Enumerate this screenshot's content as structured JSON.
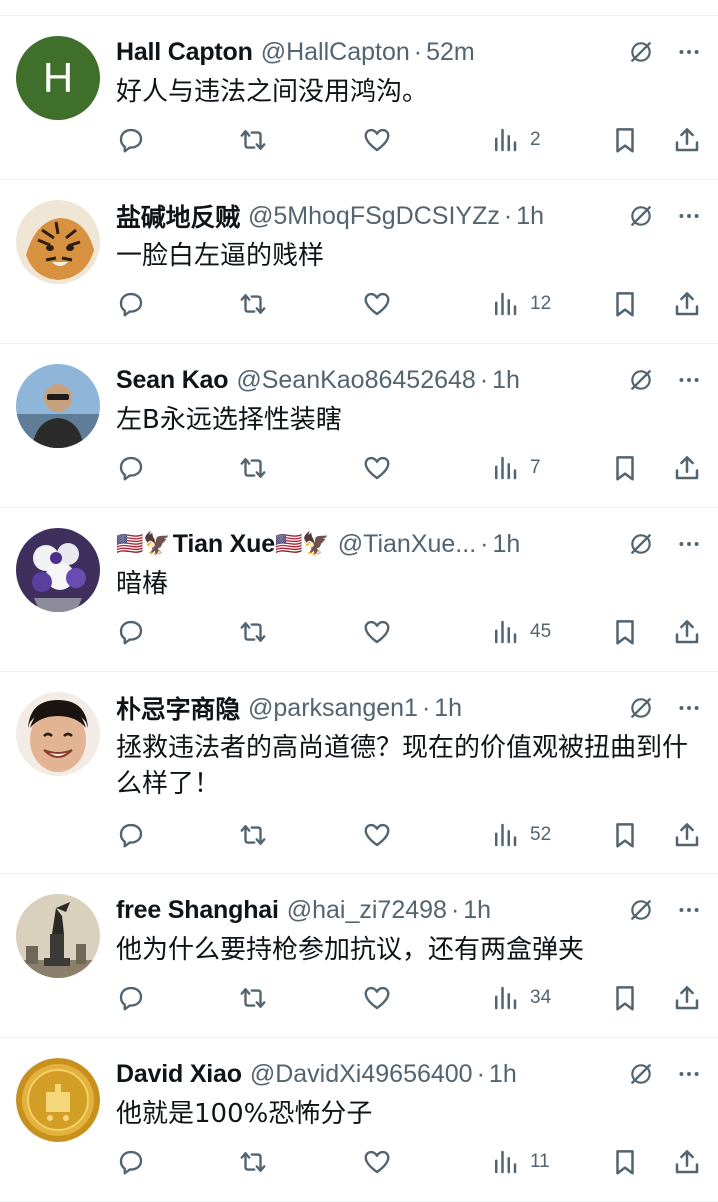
{
  "tweets": [
    {
      "name": "Hall Capton",
      "handle": "@HallCapton",
      "time": "52m",
      "text": "好人与违法之间没用鸿沟。",
      "views": "2",
      "avatar_letter": "H",
      "avatar_color": "#3f6f2b"
    },
    {
      "name": "盐碱地反贼",
      "handle": "@5MhoqFSgDCSIYZz",
      "time": "1h",
      "text": "一脸白左逼的贱样",
      "views": "12",
      "avatar_color": "#c98a3e"
    },
    {
      "name": "Sean Kao",
      "handle": "@SeanKao86452648",
      "time": "1h",
      "text": "左B永远选择性装瞎",
      "views": "7",
      "avatar_color": "#6b8fb8"
    },
    {
      "name": "Tian Xue",
      "name_emoji_prefix": "🇺🇸🦅",
      "name_emoji_suffix": "🇺🇸🦅",
      "handle": "@TianXue...",
      "time": "1h",
      "text": "暗椿",
      "views": "45",
      "avatar_color": "#5a4a8a"
    },
    {
      "name": "朴忌字商隐",
      "handle": "@parksangen1",
      "time": "1h",
      "text": "拯救违法者的高尚道德？现在的价值观被扭曲到什么样了！",
      "views": "52",
      "avatar_color": "#d9a88c"
    },
    {
      "name": "free Shanghai",
      "handle": "@hai_zi72498",
      "time": "1h",
      "text": "他为什么要持枪参加抗议，还有两盒弹夹",
      "views": "34",
      "avatar_color": "#b8ab93"
    },
    {
      "name": "David Xiao",
      "handle": "@DavidXi49656400",
      "time": "1h",
      "text": "他就是100%恐怖分子",
      "views": "11",
      "avatar_color": "#d4a02a"
    }
  ],
  "icons": {
    "header": [
      "grok-icon",
      "more-icon"
    ],
    "actions": [
      "reply-icon",
      "retweet-icon",
      "like-icon",
      "views-icon",
      "bookmark-icon",
      "share-icon"
    ]
  },
  "colors": {
    "text": "#0f1419",
    "secondary": "#536471",
    "divider": "#eff3f4"
  }
}
